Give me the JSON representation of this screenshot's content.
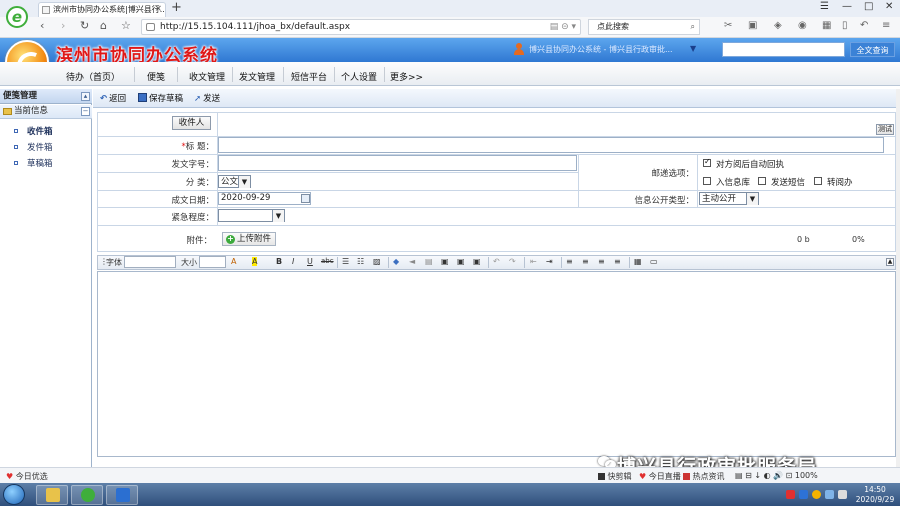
{
  "browser": {
    "tab_title": "滨州市协同办公系统|博兴县行...",
    "tab_close": "×",
    "new_tab": "+",
    "url": "http://15.15.104.111/jhoa_bx/default.aspx",
    "search_placeholder": "点此搜索",
    "logo_letter": "e"
  },
  "app": {
    "title": "滨州市协同办公系统",
    "user_org": "博兴县协同办公系统 - 博兴县行政审批...",
    "global_search_button": "全文查询",
    "menu": [
      "待办（首页）",
      "便笺",
      "收文管理",
      "发文管理",
      "短信平台",
      "个人设置",
      "更多>>"
    ]
  },
  "sidebar": {
    "header": "便笺管理",
    "group": "当前信息",
    "items": [
      "收件箱",
      "发件箱",
      "草稿箱"
    ]
  },
  "toolbar": {
    "back": "返回",
    "save_draft": "保存草稿",
    "send": "发送"
  },
  "form": {
    "recipient_button": "收件人",
    "test_button": "测试",
    "title_required_mark": "*",
    "title_label": "标    题：",
    "doc_number_label": "发文字号：",
    "mail_options_label": "邮递选项：",
    "auto_receipt": "对方阅后自动回执",
    "auto_receipt_checked": true,
    "to_info_db": "入信息库",
    "send_sms": "发送短信",
    "transfer": "转阅办",
    "category_label": "分    类：",
    "category_value": "公文",
    "date_label": "成文日期：",
    "date_value": "2020-09-29",
    "disclosure_label": "信息公开类型：",
    "disclosure_value": "主动公开",
    "urgency_label": "紧急程度：",
    "urgency_value": "",
    "attachment_label": "附件：",
    "upload_button": "上传附件",
    "upload_size": "0 b",
    "upload_percent": "0%"
  },
  "editor": {
    "font_label": "字体",
    "size_label": "大小",
    "tools": [
      "A",
      "A",
      "B",
      "I",
      "U",
      "abc"
    ]
  },
  "status": {
    "left": "今日优选",
    "items": [
      "快剪辑",
      "今日直播",
      "热点资讯"
    ],
    "watermark": "博兴县行政审批服务局"
  },
  "taskbar": {
    "time": "14:50",
    "date": "2020/9/29"
  }
}
